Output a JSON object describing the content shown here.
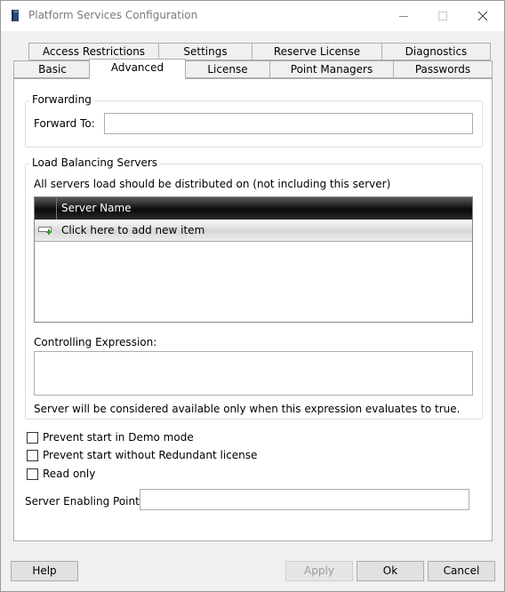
{
  "window": {
    "title": "Platform Services Configuration"
  },
  "tabs": {
    "row_back": [
      "Access Restrictions",
      "Settings",
      "Reserve License",
      "Diagnostics"
    ],
    "row_front": [
      "Basic",
      "Advanced",
      "License",
      "Point Managers",
      "Passwords"
    ],
    "active": "Advanced"
  },
  "forwarding": {
    "group_title": "Forwarding",
    "forward_to_label": "Forward To:",
    "forward_to_value": ""
  },
  "load_balancing": {
    "group_title": "Load Balancing Servers",
    "description": "All servers load should be distributed on (not including this server)",
    "grid": {
      "columns": [
        "Server Name"
      ],
      "new_row_text": "Click here to add new item",
      "rows": []
    },
    "controlling_expression_label": "Controlling Expression:",
    "controlling_expression_value": "",
    "hint": "Server will be considered available only when this expression evaluates to true."
  },
  "options": {
    "prevent_demo_label": "Prevent start in Demo mode",
    "prevent_demo_checked": false,
    "prevent_redundant_label": "Prevent start without Redundant license",
    "prevent_redundant_checked": false,
    "read_only_label": "Read only",
    "read_only_checked": false
  },
  "server_enabling_point": {
    "label": "Server Enabling Point:",
    "value": ""
  },
  "buttons": {
    "help": "Help",
    "apply": "Apply",
    "ok": "Ok",
    "cancel": "Cancel"
  }
}
